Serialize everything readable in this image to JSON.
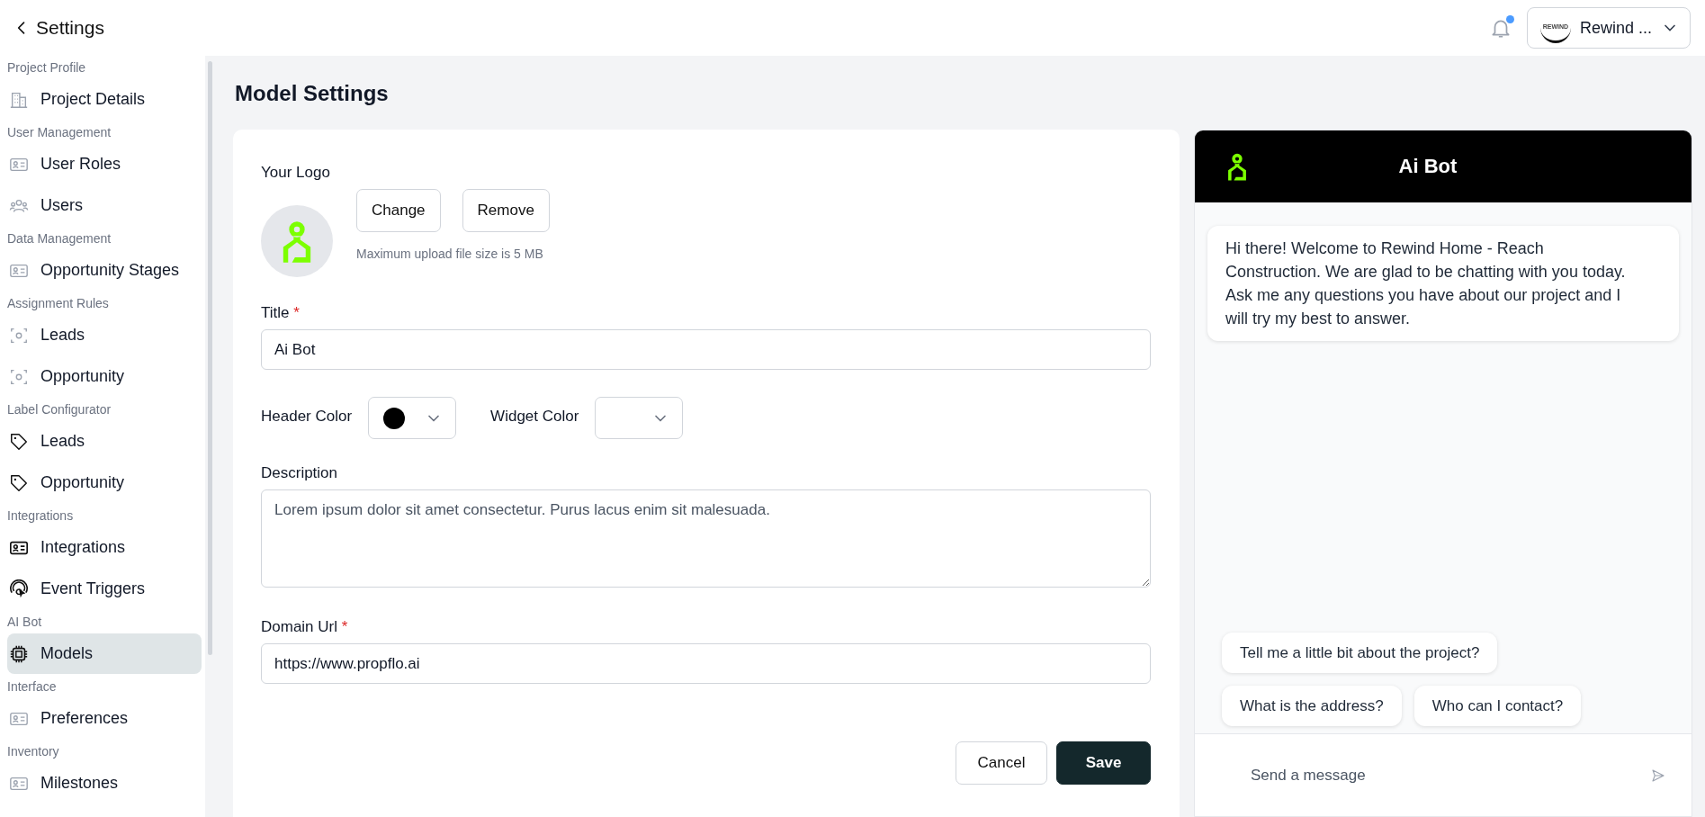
{
  "header": {
    "back_label": "Settings",
    "notifications": {
      "unread": true
    },
    "account": {
      "logo_text": "REWIND",
      "name": "Rewind ..."
    }
  },
  "sidebar": {
    "sections": [
      {
        "label": "Project Profile",
        "items": [
          {
            "label": "Project Details",
            "selected": false
          }
        ]
      },
      {
        "label": "User Management",
        "items": [
          {
            "label": "User Roles",
            "selected": false
          },
          {
            "label": "Users",
            "selected": false
          }
        ]
      },
      {
        "label": "Data Management",
        "items": [
          {
            "label": "Opportunity Stages",
            "selected": false
          }
        ]
      },
      {
        "label": "Assignment Rules",
        "items": [
          {
            "label": "Leads",
            "selected": false
          },
          {
            "label": "Opportunity",
            "selected": false
          }
        ]
      },
      {
        "label": "Label Configurator",
        "items": [
          {
            "label": "Leads",
            "selected": false
          },
          {
            "label": "Opportunity",
            "selected": false
          }
        ]
      },
      {
        "label": "Integrations",
        "items": [
          {
            "label": "Integrations",
            "selected": false
          },
          {
            "label": "Event Triggers",
            "selected": false
          }
        ]
      },
      {
        "label": "AI Bot",
        "items": [
          {
            "label": "Models",
            "selected": true
          }
        ]
      },
      {
        "label": "Interface",
        "items": [
          {
            "label": "Preferences",
            "selected": false
          }
        ]
      },
      {
        "label": "Inventory",
        "items": [
          {
            "label": "Milestones",
            "selected": false
          }
        ]
      }
    ]
  },
  "page_title": "Model Settings",
  "form": {
    "logo": {
      "label": "Your Logo",
      "buttons": [
        "Change",
        "Remove"
      ],
      "hint": "Maximum upload file size is 5 MB"
    },
    "title": {
      "label": "Title",
      "required_mark": "*",
      "value": "Ai Bot"
    },
    "header_color": {
      "label": "Header Color",
      "color": "#000000"
    },
    "widget_color": {
      "label": "Widget Color"
    },
    "description": {
      "label": "Description",
      "value": "Lorem ipsum dolor sit amet consectetur. Purus lacus enim sit malesuada."
    },
    "domain": {
      "label": "Domain Url",
      "required_mark": "*",
      "value": "https://www.propflo.ai"
    },
    "actions": [
      {
        "label": "Cancel",
        "kind": "secondary"
      },
      {
        "label": "Save",
        "kind": "primary"
      }
    ]
  },
  "chat": {
    "title": "Ai Bot",
    "message": "Hi there! Welcome to Rewind Home - Reach Construction. We are glad to be chatting with you today. Ask me any questions you have about our project and I will try my best to answer.",
    "suggestions": [
      [
        "Tell me a little bit about the project?"
      ],
      [
        "What is the address?",
        "Who can I contact?"
      ]
    ],
    "input": {
      "placeholder": "Send a message"
    }
  }
}
